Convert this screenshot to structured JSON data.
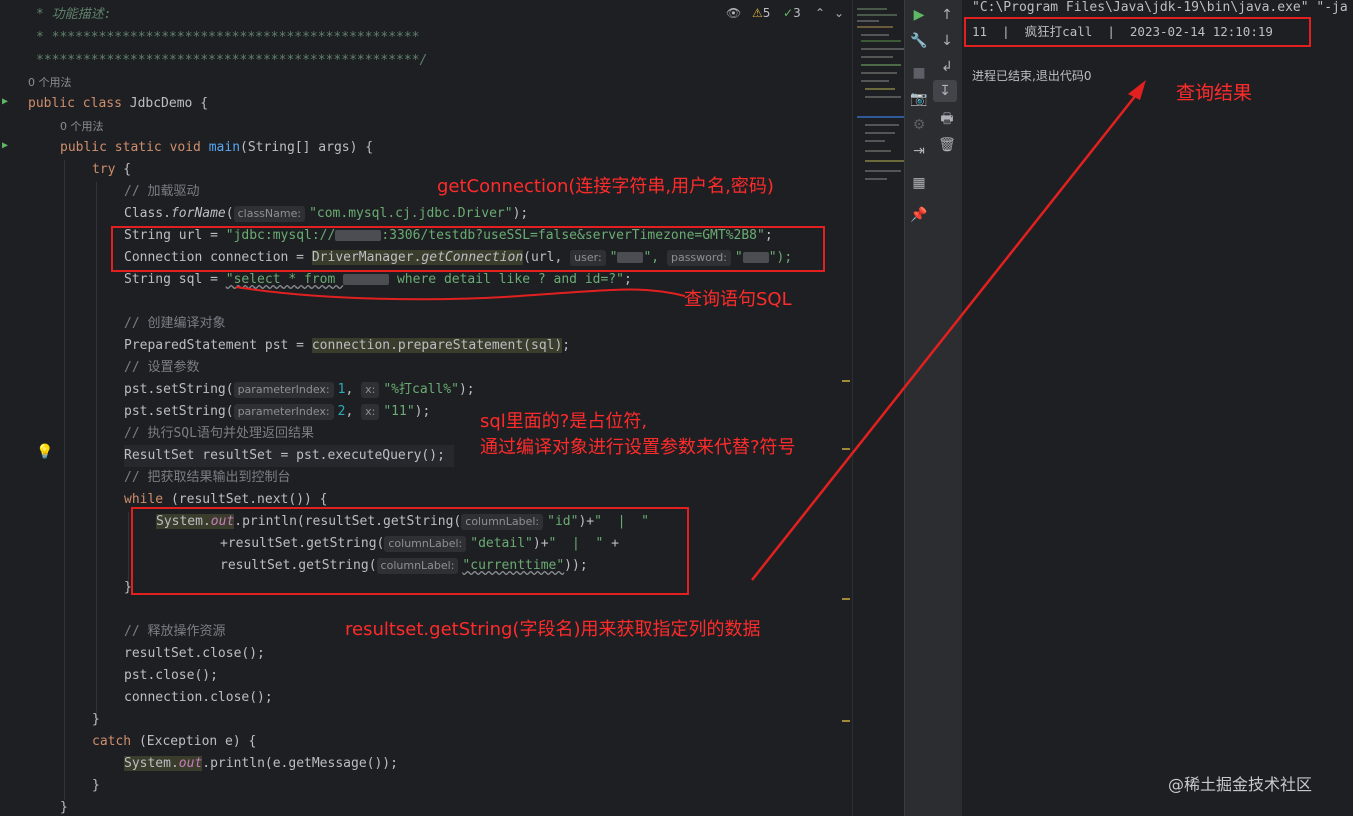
{
  "editor": {
    "inspection_warnings": "5",
    "inspection_ok": "3",
    "lines": {
      "l1": "* 功能描述:",
      "l2": "* ***********************************************",
      "l3": "*************************************************/",
      "l4": "0 个用法",
      "l5a": "public class ",
      "l5b": "JdbcDemo {",
      "l6": "0 个用法",
      "l7a": "public static void ",
      "l7b": "main",
      "l7c": "(String[] args) {",
      "l8a": "try",
      "l8b": " {",
      "l9": "// 加载驱动",
      "l10a": "Class.",
      "l10b": "forName",
      "l10c": "(",
      "l10h": "className:",
      "l10d": "\"com.mysql.cj.jdbc.Driver\"",
      "l10e": ");",
      "l11a": "String url = ",
      "l11b": "\"jdbc:mysql://",
      "l11c": ":3306/testdb?useSSL=false&serverTimezone=GMT%2B8\"",
      "l11d": ";",
      "l12a": "Connection connection = ",
      "l12b": "DriverManager.",
      "l12c": "getConnection",
      "l12d": "(url,",
      "l12h1": "user:",
      "l12e": "\"",
      "l12f": "\",",
      "l12h2": "password:",
      "l12g": "\"",
      "l12i": "\");",
      "l13a": "String sql = ",
      "l13b": "\"select * from ",
      "l13c": " where detail like ? and id=?\"",
      "l13d": ";",
      "l15": "// 创建编译对象",
      "l16a": "PreparedStatement pst = ",
      "l16b": "connection.prepareStatement(sql)",
      "l16c": ";",
      "l17": "// 设置参数",
      "l18a": "pst.setString(",
      "l18h1": "parameterIndex:",
      "l18b": "1",
      "l18c": ",",
      "l18h2": "x:",
      "l18d": "\"%打call%\"",
      "l18e": ");",
      "l19a": "pst.setString(",
      "l19h1": "parameterIndex:",
      "l19b": "2",
      "l19c": ",",
      "l19h2": "x:",
      "l19d": "\"11\"",
      "l19e": ");",
      "l20": "// 执行SQL语句并处理返回结果",
      "l21a": "ResultSet resultSet = pst.executeQuery();",
      "l22": "// 把获取结果输出到控制台",
      "l23a": "while",
      "l23b": " (resultSet.next()) {",
      "l24a": "System.",
      "l24b": "out",
      "l24c": ".println(resultSet.getString(",
      "l24h": "columnLabel:",
      "l24d": "\"id\"",
      "l24e": ")+",
      "l24f": "\"  |  \"",
      "l25a": "+resultSet.getString(",
      "l25h": "columnLabel:",
      "l25b": "\"detail\"",
      "l25c": ")+",
      "l25d": "\"  |  \"",
      "l25e": " +",
      "l26a": "resultSet.getString(",
      "l26h": "columnLabel:",
      "l26b": "\"currenttime\"",
      "l26c": "));",
      "l27": "}",
      "l29": "// 释放操作资源",
      "l30": "resultSet.close();",
      "l31": "pst.close();",
      "l32": "connection.close();",
      "l33": "}",
      "l34a": "catch",
      "l34b": " (Exception e) {",
      "l35a": "System.",
      "l35b": "out",
      "l35c": ".println(e.getMessage());",
      "l36": "}",
      "l37": "}"
    }
  },
  "console": {
    "command": "\"C:\\Program Files\\Java\\jdk-19\\bin\\java.exe\" \"-ja",
    "result_row": "11  |  疯狂打call  |  2023-02-14 12:10:19",
    "exit_message": "进程已结束,退出代码0"
  },
  "annotations": {
    "get_connection": "getConnection(连接字符串,用户名,密码)",
    "sql_query": "查询语句SQL",
    "placeholder_line1": "sql里面的?是占位符,",
    "placeholder_line2": "通过编译对象进行设置参数来代替?符号",
    "get_string": "resultset.getString(字段名)用来获取指定列的数据",
    "query_result": "查询结果"
  },
  "watermark": "@稀土掘金技术社区",
  "colors": {
    "annotation_red": "#ff2b2b",
    "editor_bg": "#1e1f22",
    "keyword": "#cf8e6d",
    "string": "#6aab73"
  },
  "icons": [
    "run-icon",
    "wrench-icon",
    "up-arrow-icon",
    "down-arrow-icon",
    "stop-icon",
    "camera-icon",
    "soft-wrap-icon",
    "scroll-to-end-icon",
    "print-icon",
    "trash-icon",
    "layout-icon",
    "pin-icon",
    "exit-icon",
    "settings-icon"
  ]
}
